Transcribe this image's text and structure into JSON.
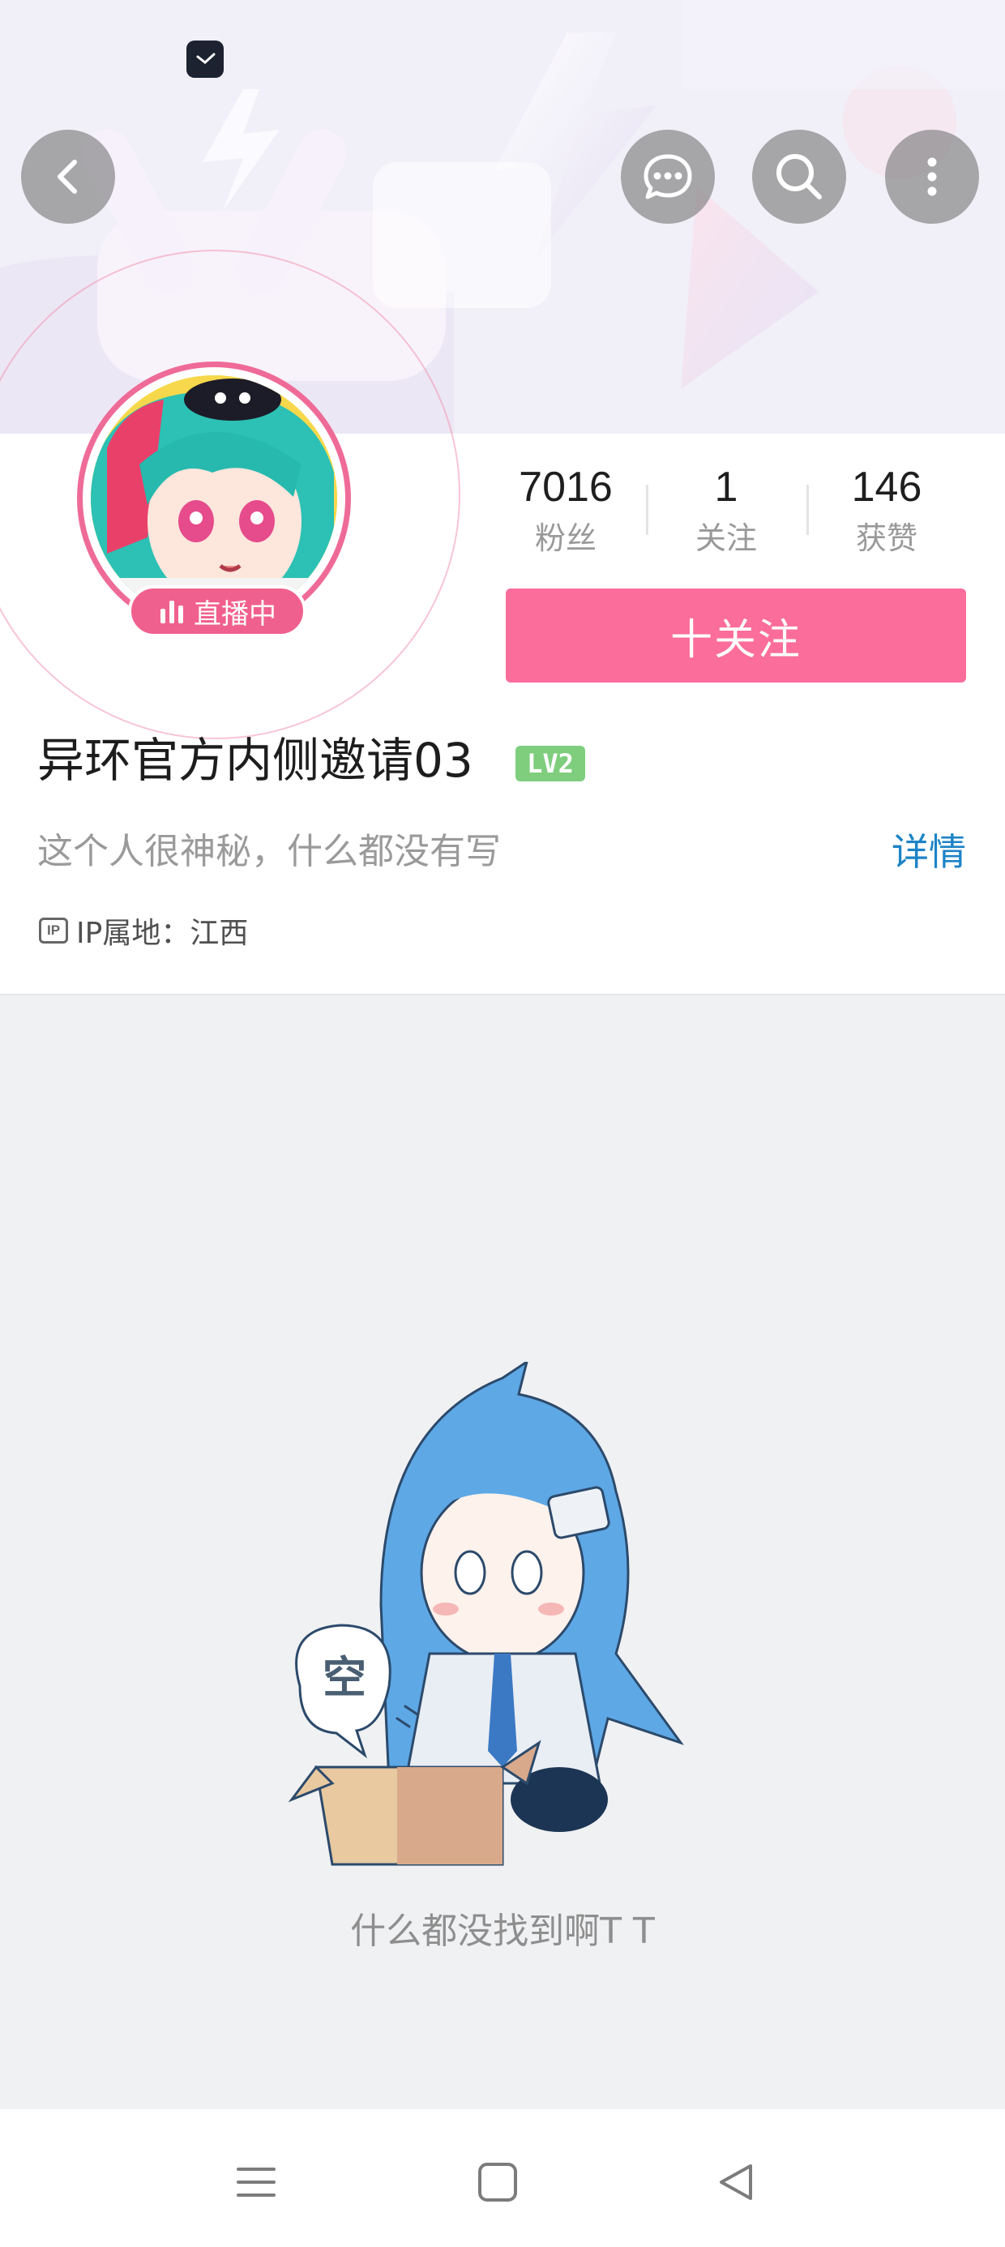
{
  "header": {
    "back_icon": "chevron-left-icon",
    "message_icon": "chat-bubble-icon",
    "search_icon": "search-icon",
    "more_icon": "more-vertical-icon"
  },
  "profile": {
    "live_label": "直播中",
    "username": "异环官方内侧邀请03",
    "level": "LV2",
    "bio": "这个人很神秘，什么都没有写",
    "details_label": "详情",
    "ip_icon_text": "IP",
    "ip_location": "IP属地：江西"
  },
  "stats": [
    {
      "value": "7016",
      "label": "粉丝"
    },
    {
      "value": "1",
      "label": "关注"
    },
    {
      "value": "146",
      "label": "获赞"
    }
  ],
  "follow_button": "十关注",
  "empty_state": {
    "bubble_text": "空",
    "message": "什么都没找到啊T T"
  },
  "colors": {
    "accent_pink": "#fb6d9b",
    "link_blue": "#1c83c6",
    "level_green": "#7fce7e"
  }
}
